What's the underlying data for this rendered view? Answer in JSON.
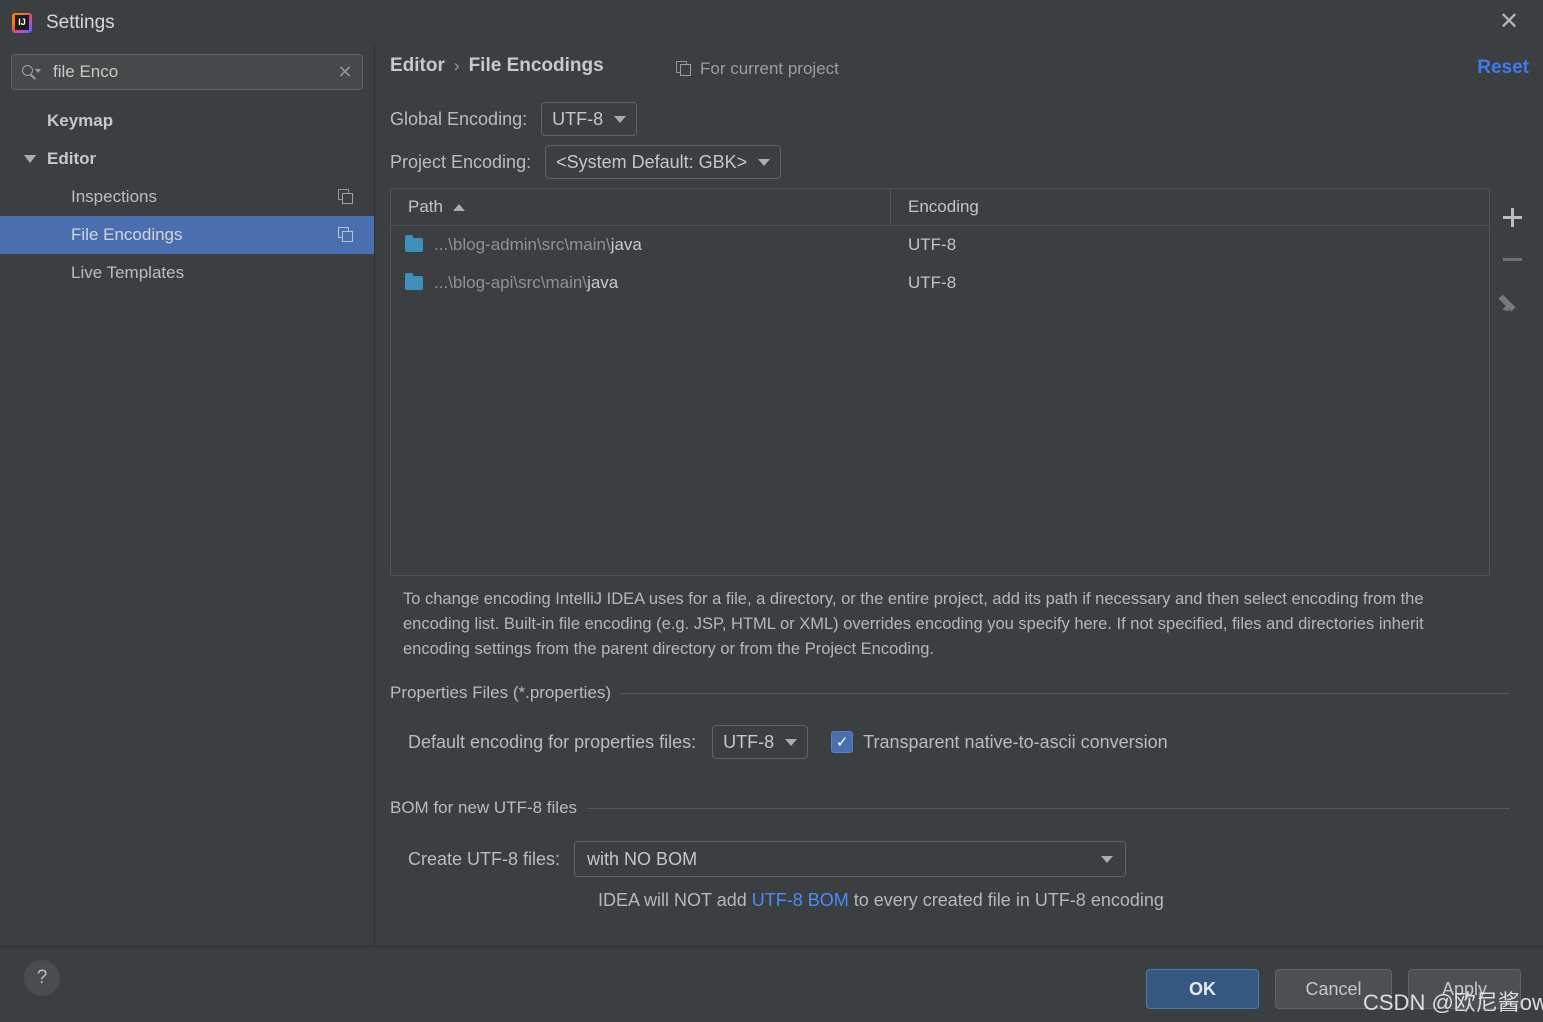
{
  "window": {
    "title": "Settings",
    "close_icon": "close-icon",
    "logo": "intellij-idea-logo"
  },
  "search": {
    "value": "file Enco",
    "clear_icon": "clear-icon",
    "icon": "search-icon"
  },
  "sidebar": {
    "items": [
      {
        "label": "Keymap",
        "type": "group",
        "selected": false,
        "has_copy_icon": false
      },
      {
        "label": "Editor",
        "type": "group",
        "selected": false,
        "has_copy_icon": false,
        "expanded": true
      },
      {
        "label": "Inspections",
        "type": "child",
        "selected": false,
        "has_copy_icon": true
      },
      {
        "label": "File Encodings",
        "type": "child",
        "selected": true,
        "has_copy_icon": true
      },
      {
        "label": "Live Templates",
        "type": "child",
        "selected": false,
        "has_copy_icon": false
      }
    ]
  },
  "header": {
    "breadcrumb": [
      "Editor",
      "File Encodings"
    ],
    "separator": "›",
    "for_current_project": "For current project",
    "reset_label": "Reset"
  },
  "encodings": {
    "global_label": "Global Encoding:",
    "global_value": "UTF-8",
    "project_label": "Project Encoding:",
    "project_value": "<System Default: GBK>"
  },
  "table": {
    "columns": [
      "Path",
      "Encoding"
    ],
    "sort_column": "Path",
    "sort_direction": "asc",
    "rows": [
      {
        "path_prefix": "...\\blog-admin\\src\\main\\",
        "path_leaf": "java",
        "encoding": "UTF-8"
      },
      {
        "path_prefix": "...\\blog-api\\src\\main\\",
        "path_leaf": "java",
        "encoding": "UTF-8"
      }
    ],
    "tools": [
      {
        "name": "add-path-button",
        "icon": "plus-icon",
        "enabled": true
      },
      {
        "name": "remove-path-button",
        "icon": "minus-icon",
        "enabled": false
      },
      {
        "name": "edit-path-button",
        "icon": "pencil-icon",
        "enabled": false
      }
    ]
  },
  "description": "To change encoding IntelliJ IDEA uses for a file, a directory, or the entire project, add its path if necessary and then select encoding from the encoding list. Built-in file encoding (e.g. JSP, HTML or XML) overrides encoding you specify here. If not specified, files and directories inherit encoding settings from the parent directory or from the Project Encoding.",
  "properties_section": {
    "title": "Properties Files (*.properties)",
    "default_encoding_label": "Default encoding for properties files:",
    "default_encoding_value": "UTF-8",
    "transparent_label": "Transparent native-to-ascii conversion",
    "transparent_checked": true,
    "check_glyph": "✓"
  },
  "bom_section": {
    "title": "BOM for new UTF-8 files",
    "create_label": "Create UTF-8 files:",
    "create_value": "with NO BOM",
    "note_before": "IDEA will NOT add ",
    "note_link": "UTF-8 BOM",
    "note_after": " to every created file in UTF-8 encoding"
  },
  "footer": {
    "help_glyph": "?",
    "ok_label": "OK",
    "cancel_label": "Cancel",
    "apply_label": "Apply"
  },
  "watermark": "CSDN @欧尼酱owo",
  "colors": {
    "background": "#3c3f41",
    "selection": "#4b6eaf",
    "accent_link": "#3d7bf0",
    "folder": "#3f8fbb",
    "ok_button": "#365880"
  }
}
